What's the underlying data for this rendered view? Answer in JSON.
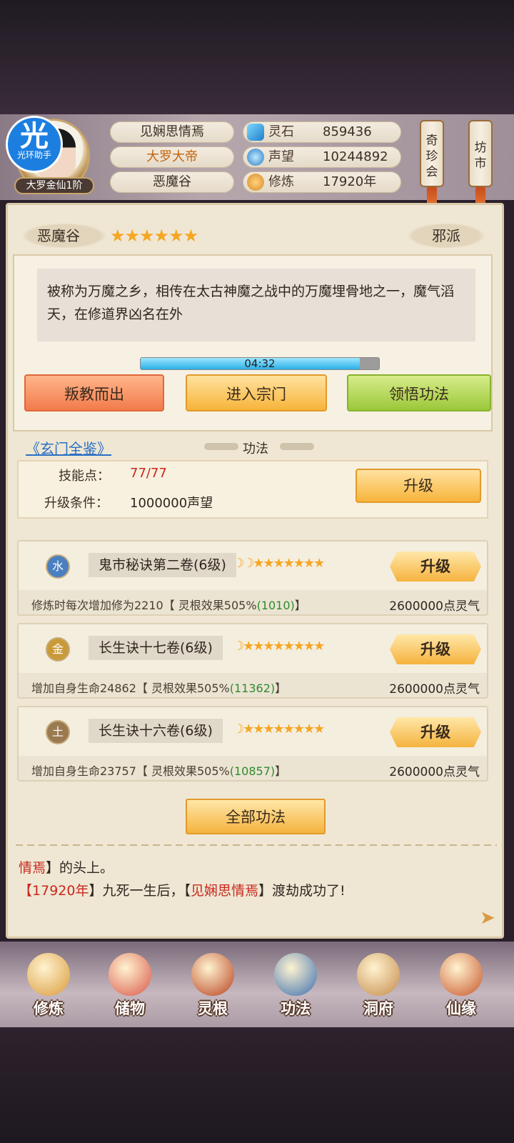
{
  "header": {
    "badge_big": "光",
    "badge_small": "光环助手",
    "rank": "大罗金仙1阶",
    "name": "见娴思情焉",
    "title": "大罗大帝",
    "sect": "恶魔谷",
    "stats": [
      {
        "label": "灵石",
        "value": "859436",
        "icon": "spirit-stone-icon"
      },
      {
        "label": "声望",
        "value": "10244892",
        "icon": "prestige-icon"
      },
      {
        "label": "修炼",
        "value": "17920年",
        "icon": "meditation-icon"
      }
    ],
    "side_buttons": [
      "奇珍会",
      "坊市"
    ]
  },
  "faction": {
    "name": "恶魔谷",
    "stars": "★★★★★★",
    "type": "邪派",
    "description": "被称为万魔之乡，相传在太古神魔之战中的万魔埋骨地之一，魔气滔天，在修道界凶名在外",
    "timer": "04:32",
    "timer_progress": 0.92,
    "buttons": [
      "叛教而出",
      "进入宗门",
      "领悟功法"
    ]
  },
  "section": {
    "link": "《玄门全鉴》",
    "label": "功法"
  },
  "skill": {
    "points_label": "技能点：",
    "points_value": "77/77",
    "cond_label": "升级条件：",
    "cond_value": "1000000声望",
    "upgrade": "升级"
  },
  "techniques": [
    {
      "element": "水",
      "name": "鬼市秘诀第二卷(6级)",
      "rating": "☽☽★★★★★★★",
      "upgrade": "升级",
      "desc": "修炼时每次增加修为2210【 灵根效果505%",
      "bonus": "(1010)",
      "tail": "】",
      "cost": "2600000点灵气",
      "color": "#4a7fc0"
    },
    {
      "element": "金",
      "name": "长生诀十七卷(6级)",
      "rating": "☽★★★★★★★★",
      "upgrade": "升级",
      "desc": "增加自身生命24862【 灵根效果505%",
      "bonus": "(11362)",
      "tail": "】",
      "cost": "2600000点灵气",
      "color": "#c99a3a"
    },
    {
      "element": "土",
      "name": "长生诀十六卷(6级)",
      "rating": "☽★★★★★★★★",
      "upgrade": "升级",
      "desc": "增加自身生命23757【 灵根效果505%",
      "bonus": "(10857)",
      "tail": "】",
      "cost": "2600000点灵气",
      "color": "#9a7a50"
    }
  ],
  "all_button": "全部功法",
  "log": {
    "line1_red": "情焉",
    "line1_rest": "】的头上。",
    "line2_a": "【",
    "line2_b": "17920年",
    "line2_c": "】九死一生后，【",
    "line2_d": "见娴思情焉",
    "line2_e": "】渡劫成功了!"
  },
  "nav": [
    {
      "label": "修炼",
      "icon": "meditation-monk-icon",
      "color": "#d99a3a"
    },
    {
      "label": "储物",
      "icon": "storage-bag-icon",
      "color": "#d9574a"
    },
    {
      "label": "灵根",
      "icon": "spirit-root-icon",
      "color": "#b8401e"
    },
    {
      "label": "功法",
      "icon": "technique-book-icon",
      "color": "#3b6fb0"
    },
    {
      "label": "洞府",
      "icon": "cave-dwelling-icon",
      "color": "#c58a4a"
    },
    {
      "label": "仙缘",
      "icon": "gourd-icon",
      "color": "#c8562a"
    }
  ]
}
